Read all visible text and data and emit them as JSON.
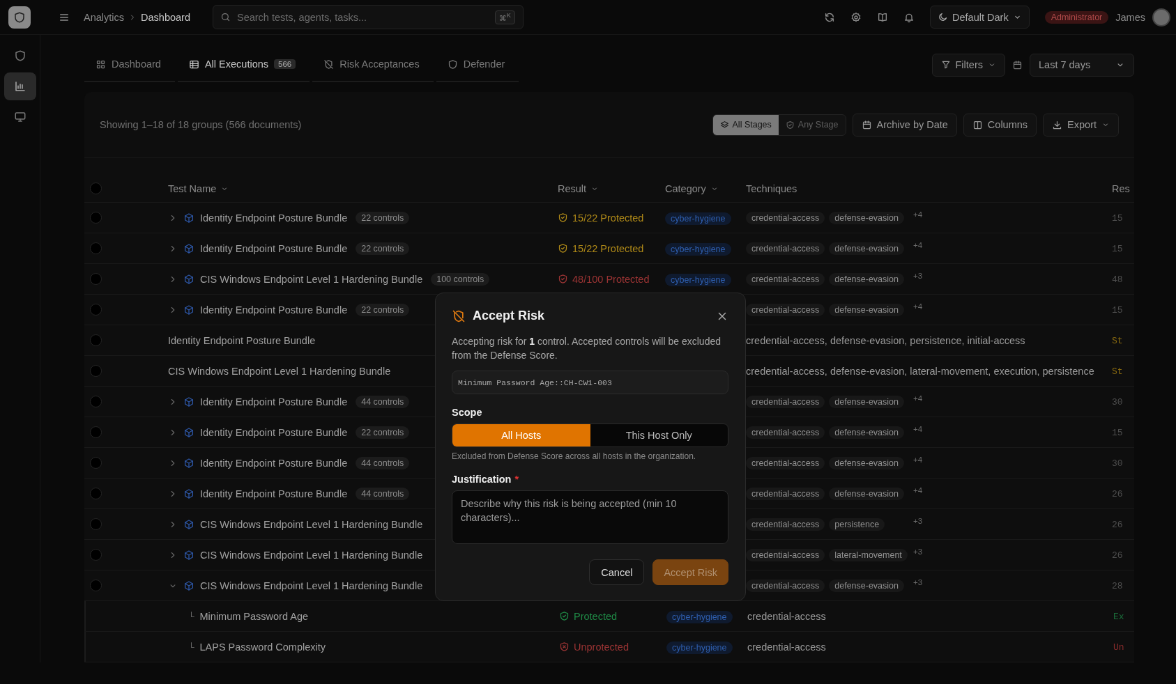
{
  "sidebar": [
    {
      "kind": "shield",
      "selected": false
    },
    {
      "kind": "chart",
      "selected": true
    },
    {
      "kind": "monitor",
      "selected": false
    }
  ],
  "topbar": {
    "breadcrumb": [
      "Analytics",
      "Dashboard"
    ],
    "search": {
      "placeholder": "Search tests, agents, tasks...",
      "shortcut": "⌘$^{K}$"
    },
    "theme": "Default Dark",
    "role": "Administrator",
    "user": "James"
  },
  "tabs": [
    {
      "label": "Dashboard",
      "kind": "grid",
      "selected": false
    },
    {
      "label": "All Executions",
      "kind": "table",
      "count": "566",
      "selected": true
    },
    {
      "label": "Risk Acceptances",
      "kind": "shield-off",
      "selected": false
    },
    {
      "label": "Defender",
      "kind": "shield",
      "selected": false
    }
  ],
  "filters": {
    "label": "Filters",
    "date_range": "Last 7 days"
  },
  "summary": "Showing 1–18 of 18 groups (566 documents)",
  "stage_toggle": [
    {
      "label": "All Stages",
      "selected": true
    },
    {
      "label": "Any Stage",
      "selected": false
    }
  ],
  "actions": [
    {
      "label": "Archive by Date",
      "kind": "calendar"
    },
    {
      "label": "Columns",
      "kind": "columns"
    },
    {
      "label": "Export",
      "kind": "export"
    }
  ],
  "table": {
    "columns": [
      {
        "label": "Test Name",
        "sortable": true
      },
      {
        "label": "Result",
        "sortable": true
      },
      {
        "label": "Category",
        "sortable": true
      },
      {
        "label": "Techniques",
        "sortable": false
      },
      {
        "label": "Res",
        "sortable": false
      }
    ],
    "all_checked": false,
    "rows": [
      {
        "kind": "group",
        "checked": false,
        "expanded": false,
        "name": "Identity Endpoint Posture Bundle",
        "badge": "22 controls",
        "result": {
          "text": "15/22 Protected",
          "kind": "check",
          "color": "#b08a18"
        },
        "category": "cyber-hygiene",
        "techniques": [
          "credential-access",
          "defense-evasion"
        ],
        "more": "+4",
        "column_5": {
          "text": "15",
          "color": "#4e4e4e"
        }
      },
      {
        "kind": "group",
        "checked": false,
        "expanded": false,
        "name": "Identity Endpoint Posture Bundle",
        "badge": "22 controls",
        "result": {
          "text": "15/22 Protected",
          "kind": "check",
          "color": "#b08a18"
        },
        "category": "cyber-hygiene",
        "techniques": [
          "credential-access",
          "defense-evasion"
        ],
        "more": "+4",
        "column_5": {
          "text": "15",
          "color": "#4e4e4e"
        }
      },
      {
        "kind": "group",
        "checked": false,
        "expanded": false,
        "name": "CIS Windows Endpoint Level 1 Hardening Bundle",
        "badge": "100 controls",
        "result": {
          "text": "48/100 Protected",
          "kind": "check",
          "color": "#9c3434"
        },
        "category": "cyber-hygiene",
        "techniques": [
          "credential-access",
          "defense-evasion"
        ],
        "more": "+3",
        "column_5": {
          "text": "48",
          "color": "#4e4e4e"
        }
      },
      {
        "kind": "group",
        "checked": false,
        "expanded": false,
        "name": "Identity Endpoint Posture Bundle",
        "badge": "22 controls",
        "techniques": [
          "credential-access",
          "defense-evasion"
        ],
        "more": "+4",
        "column_5": {
          "text": "15",
          "color": "#4e4e4e"
        }
      },
      {
        "kind": "plain",
        "checked": false,
        "name": "Identity Endpoint Posture Bundle",
        "techniques_text": "credential-access, defense-evasion, persistence, initial-access",
        "column_5": {
          "text": "St",
          "color": "#8a6b10"
        }
      },
      {
        "kind": "plain",
        "checked": false,
        "name": "CIS Windows Endpoint Level 1 Hardening Bundle",
        "techniques_text": "credential-access, defense-evasion, lateral-movement, execution, persistence",
        "column_5": {
          "text": "St",
          "color": "#8a6b10"
        }
      },
      {
        "kind": "group",
        "checked": false,
        "expanded": false,
        "name": "Identity Endpoint Posture Bundle",
        "badge": "44 controls",
        "techniques": [
          "credential-access",
          "defense-evasion"
        ],
        "more": "+4",
        "column_5": {
          "text": "30",
          "color": "#4e4e4e"
        }
      },
      {
        "kind": "group",
        "checked": false,
        "expanded": false,
        "name": "Identity Endpoint Posture Bundle",
        "badge": "22 controls",
        "techniques": [
          "credential-access",
          "defense-evasion"
        ],
        "more": "+4",
        "column_5": {
          "text": "15",
          "color": "#4e4e4e"
        }
      },
      {
        "kind": "group",
        "checked": false,
        "expanded": false,
        "name": "Identity Endpoint Posture Bundle",
        "badge": "44 controls",
        "techniques": [
          "credential-access",
          "defense-evasion"
        ],
        "more": "+4",
        "column_5": {
          "text": "30",
          "color": "#4e4e4e"
        }
      },
      {
        "kind": "group",
        "checked": false,
        "expanded": false,
        "name": "Identity Endpoint Posture Bundle",
        "badge": "44 controls",
        "techniques": [
          "credential-access",
          "defense-evasion"
        ],
        "more": "+4",
        "column_5": {
          "text": "26",
          "color": "#4e4e4e"
        }
      },
      {
        "kind": "group",
        "checked": false,
        "expanded": false,
        "name": "CIS Windows Endpoint Level 1 Hardening Bundle",
        "techniques": [
          "credential-access",
          "persistence"
        ],
        "more": "+3",
        "column_5": {
          "text": "26",
          "color": "#4e4e4e"
        }
      },
      {
        "kind": "group",
        "checked": false,
        "expanded": false,
        "name": "CIS Windows Endpoint Level 1 Hardening Bundle",
        "techniques": [
          "credential-access",
          "lateral-movement"
        ],
        "more": "+3",
        "column_5": {
          "text": "26",
          "color": "#4e4e4e"
        }
      },
      {
        "kind": "group",
        "checked": false,
        "expanded": true,
        "name": "CIS Windows Endpoint Level 1 Hardening Bundle",
        "techniques": [
          "credential-access",
          "defense-evasion"
        ],
        "more": "+3",
        "column_5": {
          "text": "28",
          "color": "#4e4e4e"
        },
        "children": [
          {
            "kind": "control",
            "branch": "└",
            "name": "Minimum Password Age",
            "result": {
              "text": "Protected",
              "kind": "check",
              "color": "#1f8a46"
            },
            "category": "cyber-hygiene",
            "techniques_text": "credential-access",
            "column_5": {
              "text": "Ex",
              "color": "#1a6e3a"
            }
          },
          {
            "kind": "control",
            "branch": "└",
            "name": "LAPS Password Complexity",
            "result": {
              "text": "Unprotected",
              "kind": "x",
              "color": "#9c3434"
            },
            "category": "cyber-hygiene",
            "techniques_text": "credential-access",
            "column_5": {
              "text": "Un",
              "color": "#8a2c2c"
            }
          }
        ]
      }
    ]
  },
  "modal": {
    "title": "Accept Risk",
    "message": "Accepting risk for **1** control. Accepted controls will be excluded from the Defense Score.",
    "control_field": "Minimum Password Age::CH-CW1-003",
    "scope_label": "Scope",
    "scope_options": [
      {
        "label": "All Hosts",
        "selected": true
      },
      {
        "label": "This Host Only",
        "selected": false
      }
    ],
    "scope_hint": "Excluded from Defense Score across all hosts in the organization.",
    "justification_label": "Justification",
    "required_mark": "*",
    "justification_placeholder": "Describe why this risk is being accepted (min 10 characters)...",
    "buttons": [
      {
        "label": "Cancel",
        "kind": "secondary"
      },
      {
        "label": "Accept Risk",
        "kind": "primary"
      }
    ]
  }
}
